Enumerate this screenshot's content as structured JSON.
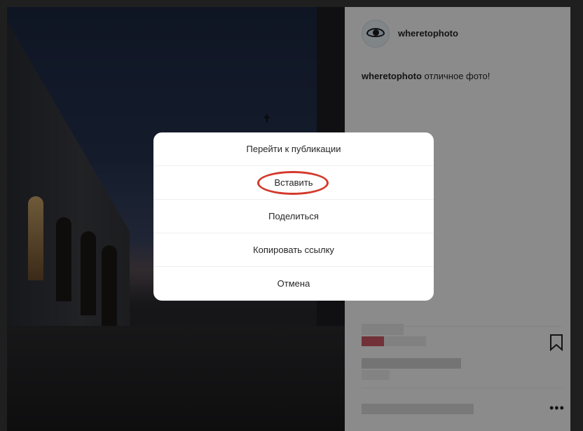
{
  "post": {
    "username": "wheretophoto",
    "caption_user": "wheretophoto",
    "caption_text": " отличное фото!"
  },
  "modal": {
    "items": [
      {
        "label": "Перейти к публикации"
      },
      {
        "label": "Вставить"
      },
      {
        "label": "Поделиться"
      },
      {
        "label": "Копировать ссылку"
      },
      {
        "label": "Отмена"
      }
    ]
  },
  "colors": {
    "highlight": "#d33a2c",
    "modal_bg": "#ffffff",
    "panel_bg": "#fdfdfd",
    "overlay": "rgba(0,0,0,0.45)"
  },
  "icons": {
    "bookmark": "bookmark-icon",
    "more": "more-options-icon",
    "avatar": "eye-logo-avatar"
  }
}
